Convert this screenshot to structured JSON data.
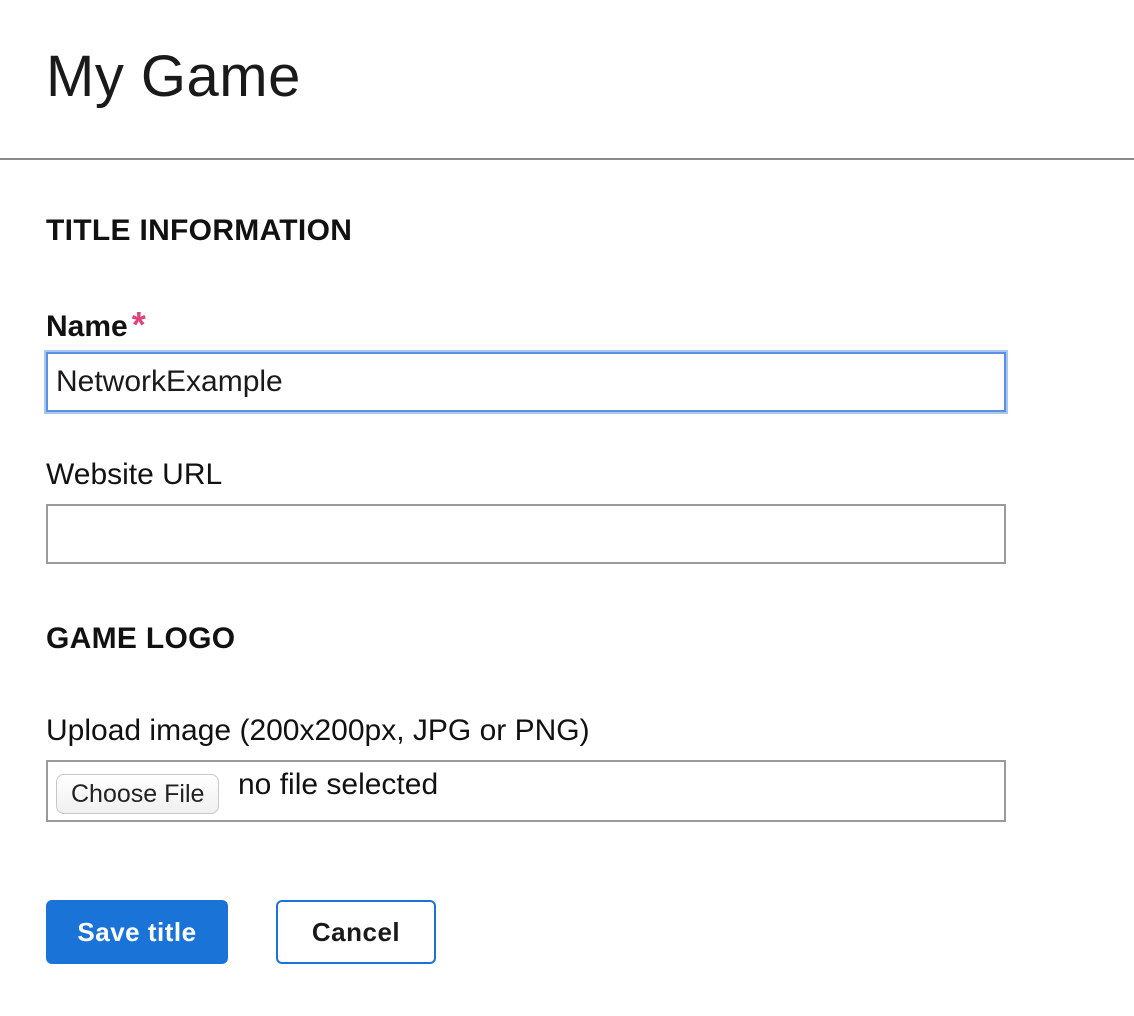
{
  "header": {
    "title": "My Game"
  },
  "sections": {
    "title_information": {
      "heading": "TITLE INFORMATION",
      "name": {
        "label": "Name",
        "required_marker": "*",
        "value": "NetworkExample"
      },
      "website_url": {
        "label": "Website URL",
        "value": ""
      }
    },
    "game_logo": {
      "heading": "GAME LOGO",
      "upload": {
        "label": "Upload image (200x200px, JPG or PNG)",
        "button_label": "Choose File",
        "status": "no file selected"
      }
    }
  },
  "actions": {
    "save_label": "Save title",
    "cancel_label": "Cancel"
  },
  "colors": {
    "primary": "#1a73d6",
    "required": "#e0427a",
    "focus_ring": "#5b8fe0"
  }
}
